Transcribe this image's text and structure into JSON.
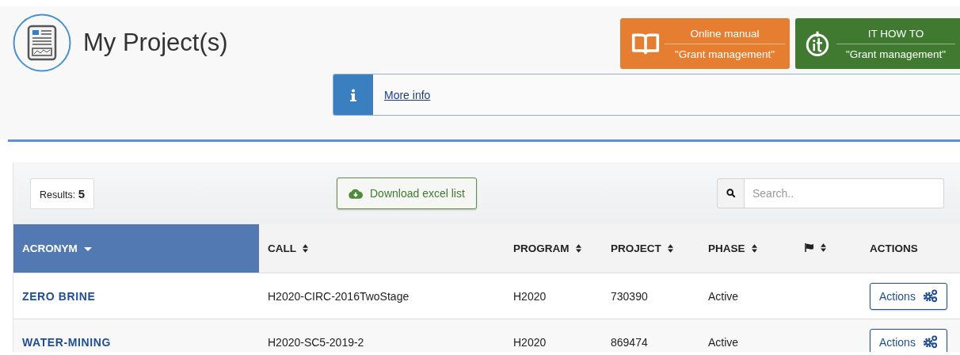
{
  "page_title": "My Project(s)",
  "help_buttons": [
    {
      "kind": "manual",
      "title": "Online manual",
      "subtitle": "\"Grant management\""
    },
    {
      "kind": "howto",
      "title": "IT HOW TO",
      "subtitle": "\"Grant management\""
    }
  ],
  "info_bar": {
    "link": "More info"
  },
  "toolbar": {
    "results_label": "Results:",
    "results_count": "5",
    "download_button": "Download excel list",
    "search": {
      "placeholder": "Search.."
    }
  },
  "table": {
    "columns": [
      {
        "kind": "text",
        "label": "ACRONYM",
        "sorted": true,
        "selected": true
      },
      {
        "kind": "text",
        "label": "CALL",
        "sortable": true,
        "sorted": false,
        "selected": false
      },
      {
        "kind": "text",
        "label": "PROGRAM",
        "sortable": true,
        "sorted": false,
        "selected": false
      },
      {
        "kind": "text",
        "label": "PROJECT",
        "sortable": true,
        "sorted": false,
        "selected": false
      },
      {
        "kind": "text",
        "label": "PHASE",
        "sortable": true,
        "sorted": false,
        "selected": false
      },
      {
        "kind": "flag",
        "sortable": true,
        "sorted": false,
        "selected": false
      },
      {
        "kind": "text",
        "label": "ACTIONS",
        "sortable": false,
        "sorted": false,
        "selected": false
      }
    ],
    "rows": [
      {
        "acronym": "ZERO BRINE",
        "call": "H2020-CIRC-2016TwoStage",
        "program": "H2020",
        "project": "730390",
        "phase": "Active",
        "action": "Actions"
      },
      {
        "acronym": "WATER-MINING",
        "call": "H2020-SC5-2019-2",
        "program": "H2020",
        "project": "869474",
        "phase": "Active",
        "action": "Actions"
      }
    ]
  }
}
